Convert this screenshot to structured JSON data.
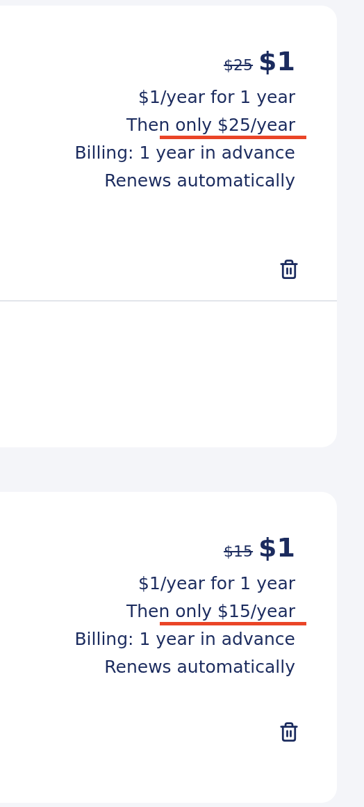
{
  "cards": [
    {
      "original_price": "$25",
      "price": "$1",
      "divider": true,
      "lines": [
        {
          "text": "$1/year for 1 year",
          "underlined": false
        },
        {
          "text": "Then only $25/year",
          "underlined": true
        },
        {
          "text": "Billing: 1 year in advance",
          "underlined": false
        },
        {
          "text": "Renews automatically",
          "underlined": false
        }
      ]
    },
    {
      "original_price": "$15",
      "price": "$1",
      "divider": false,
      "lines": [
        {
          "text": "$1/year for 1 year",
          "underlined": false
        },
        {
          "text": "Then only $15/year",
          "underlined": true
        },
        {
          "text": "Billing: 1 year in advance",
          "underlined": false
        },
        {
          "text": "Renews automatically",
          "underlined": false
        }
      ]
    }
  ]
}
